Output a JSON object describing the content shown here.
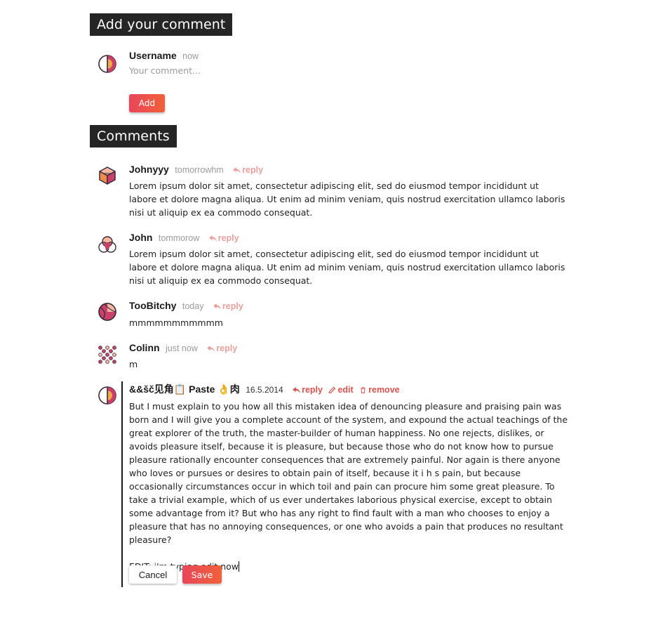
{
  "add_section": {
    "heading": "Add your comment",
    "username": "Username",
    "time": "now",
    "placeholder": "Your comment...",
    "add_label": "Add"
  },
  "comments_section": {
    "heading": "Comments",
    "reply_label": "reply",
    "edit_label": "edit",
    "remove_label": "remove",
    "items": [
      {
        "name": "Johnyyy",
        "time": "tomorrowhm",
        "avatar": "cube-avatar-icon",
        "text": "Lorem ipsum dolor sit amet, consectetur adipiscing elit, sed do eiusmod tempor incididunt ut labore et dolore magna aliqua. Ut enim ad minim veniam, quis nostrud exercitation ullamco laboris nisi ut aliquip ex ea commodo consequat."
      },
      {
        "name": "John",
        "time": "tommorow",
        "avatar": "venn-avatar-icon",
        "text": "Lorem ipsum dolor sit amet, consectetur adipiscing elit, sed do eiusmod tempor incididunt ut labore et dolore magna aliqua. Ut enim ad minim veniam, quis nostrud exercitation ullamco laboris nisi ut aliquip ex ea commodo consequat."
      },
      {
        "name": "TooBitchy",
        "time": "today",
        "avatar": "ball-avatar-icon",
        "text": "mmmmmmmmmmm"
      },
      {
        "name": "Colinn",
        "time": "just now",
        "avatar": "dots-avatar-icon",
        "text": "m"
      }
    ],
    "editing": {
      "name": "&&šč见角📋 Paste 👌肉",
      "time": "16.5.2014",
      "avatar": "half-circle-avatar-icon",
      "text_paragraph": "But I must explain to you how all this mistaken idea of denouncing pleasure and praising pain was born and I will give you a complete account of the system, and expound the actual teachings of the great explorer of the truth, the master-builder of human happiness. No one rejects, dislikes, or avoids pleasure itself, because it is pleasure, but because those who do not know how to pursue pleasure rationally encounter consequences that are extremely painful. Nor again is there anyone who loves or pursues or desires to obtain pain of itself, because it i h s pain, but because occasionally circumstances occur in which toil and pain can procure him some great pleasure. To take a trivial example, which of us ever undertakes laborious physical exercise, except to obtain some advantage from it? But who has any right to find fault with a man who chooses to enjoy a pleasure that has no annoying consequences, or one who avoids a pain that produces no resultant pleasure?",
      "text_edit_line": "EDIT: i'm typing edit now",
      "cancel_label": "Cancel",
      "save_label": "Save"
    }
  },
  "colors": {
    "heading_bg": "#252525",
    "accent_start": "#e8465a",
    "accent_end": "#f0613a",
    "reply_color": "#e8a09c",
    "action_color": "#d9534f"
  }
}
